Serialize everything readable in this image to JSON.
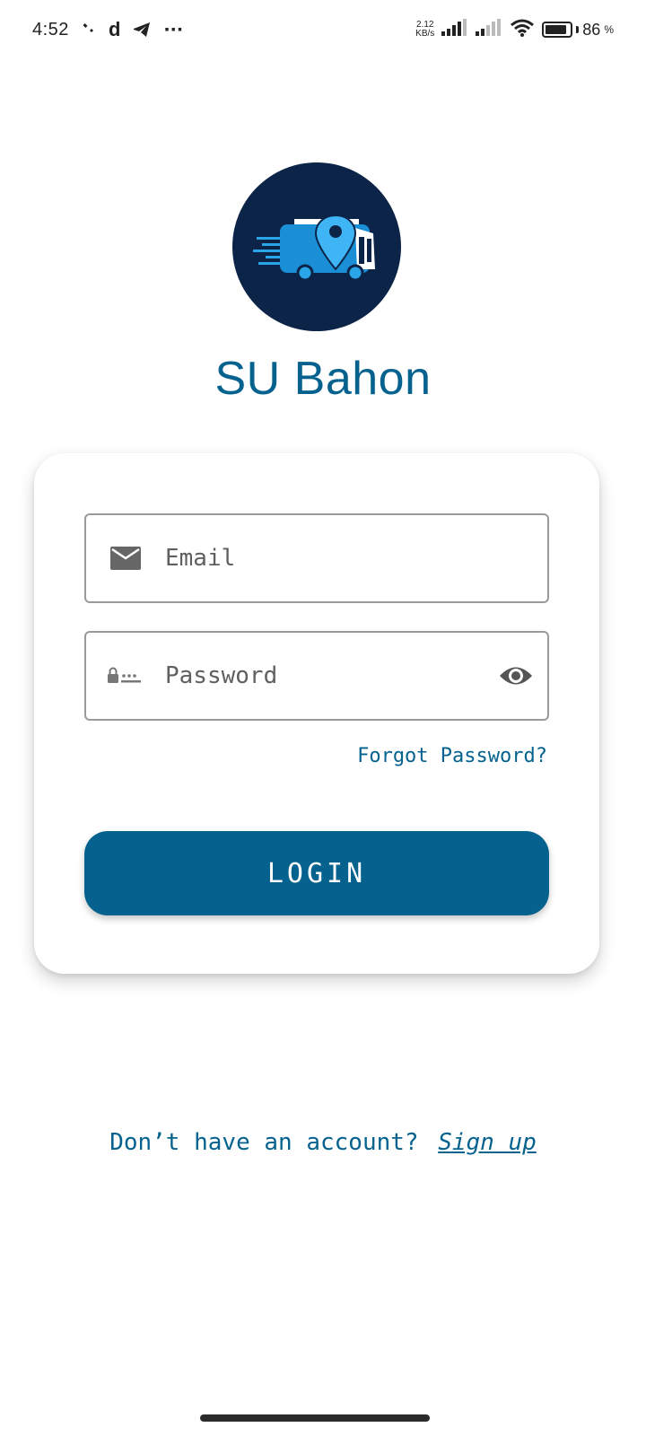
{
  "status_bar": {
    "time": "4:52",
    "icons": [
      "wrench-icon",
      "d-app-icon",
      "telegram-icon",
      "more-dots-icon"
    ],
    "speed_value": "2.12",
    "speed_unit": "KB/s",
    "battery_percent": "86",
    "battery_sign": "%"
  },
  "app": {
    "title": "SU Bahon",
    "logo_icon": "bus-location-icon",
    "brand_color": "#05628f",
    "logo_bg": "#0b2447"
  },
  "form": {
    "email_placeholder": "Email",
    "password_placeholder": "Password",
    "forgot_label": "Forgot Password?",
    "login_label": "LOGIN"
  },
  "footer": {
    "prompt": "Don’t have an account?",
    "signup_label": "Sign up"
  }
}
